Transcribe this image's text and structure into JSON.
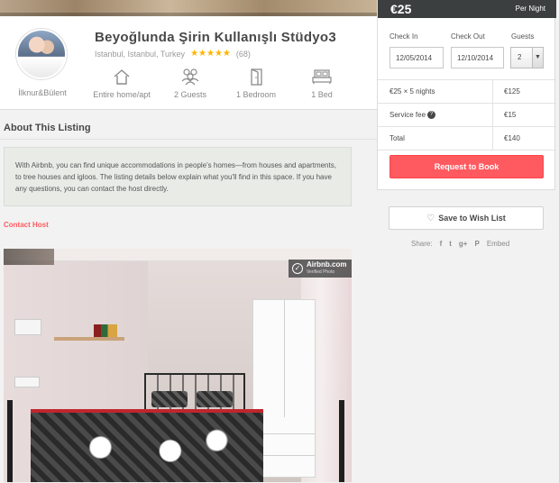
{
  "listing": {
    "title": "Beyoğlunda Şirin Kullanışlı Stüdyo3",
    "location": "Istanbul, Istanbul, Turkey",
    "rating_stars": "★★★★★",
    "reviews": "(68)",
    "host": "İlknur&Bülent",
    "facts": [
      {
        "icon": "home-icon",
        "label": "Entire home/apt"
      },
      {
        "icon": "guests-icon",
        "label": "2 Guests"
      },
      {
        "icon": "door-icon",
        "label": "1 Bedroom"
      },
      {
        "icon": "bed-icon",
        "label": "1 Bed"
      }
    ]
  },
  "about": {
    "title": "About This Listing",
    "text": "With Airbnb, you can find unique accommodations in people's homes—from houses and apartments, to tree houses and igloos. The listing details below explain what you'll find in this space. If you have any questions, you can contact the host directly.",
    "contact_link": "Contact Host"
  },
  "photo": {
    "badge_title": "Airbnb.com",
    "badge_subtitle": "Verified Photo"
  },
  "booking": {
    "price": "€25",
    "per": "Per Night",
    "checkin_label": "Check In",
    "checkin_value": "12/05/2014",
    "checkout_label": "Check Out",
    "checkout_value": "12/10/2014",
    "guests_label": "Guests",
    "guests_value": "2",
    "rows": [
      {
        "label": "€25 × 5 nights",
        "value": "€125"
      },
      {
        "label": "Service fee",
        "value": "€15"
      },
      {
        "label": "Total",
        "value": "€140"
      }
    ],
    "book_button": "Request to Book"
  },
  "wishlist": {
    "button": "Save to Wish List"
  },
  "share": {
    "label": "Share:",
    "facebook": "f",
    "twitter": "t",
    "googleplus": "g+",
    "pinterest": "P",
    "embed": "Embed"
  },
  "colors": {
    "accent": "#ff5a5f",
    "price_bar": "#3c3f40",
    "star": "#ffb400"
  }
}
